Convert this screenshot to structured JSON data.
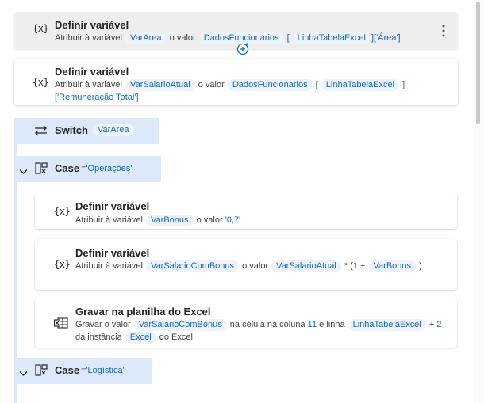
{
  "steps": [
    {
      "icon": "{x}",
      "title": "Definir variável",
      "desc": {
        "assign": "Atribuir à variável",
        "var": "VarArea",
        "value_label": "o valor",
        "expr_var": "DadosFuncionarios",
        "bracket_open": "[",
        "index_var": "LinhaTabelaExcel",
        "tail": "]['Área']"
      }
    },
    {
      "icon": "{x}",
      "title": "Definir variável",
      "desc": {
        "assign": "Atribuir à variável",
        "var": "VarSalarioAtual",
        "value_label": "o valor",
        "expr_var": "DadosFuncionarios",
        "bracket_open": "[",
        "index_var": "LinhaTabelaExcel",
        "bracket_close": "]",
        "tail": "['Remuneração Total']"
      }
    }
  ],
  "switch": {
    "label": "Switch",
    "var": "VarArea"
  },
  "case1": {
    "label": "Case",
    "eq": "=",
    "value": "'Operações'",
    "actions": [
      {
        "icon": "{x}",
        "title": "Definir variável",
        "assign": "Atribuir à variável",
        "var": "VarBonus",
        "value_label": "o valor",
        "value": "'0,7'"
      },
      {
        "icon": "{x}",
        "title": "Definir variável",
        "assign": "Atribuir à variável",
        "var": "VarSalarioComBonus",
        "value_label": "o valor",
        "expr_var": "VarSalarioAtual",
        "op": "* (1 +",
        "expr_var2": "VarBonus",
        "close": ")"
      },
      {
        "icon": "excel-write",
        "title": "Gravar na planilha do Excel",
        "write": "Gravar o valor",
        "var": "VarSalarioComBonus",
        "col_label": "na célula na coluna",
        "col": "11",
        "row_label": "e linha",
        "row_var": "LinhaTabelaExcel",
        "plus": "+",
        "plus_val": "2",
        "inst_label": "da instância",
        "inst_var": "Excel",
        "suffix": "do Excel"
      }
    ]
  },
  "case2": {
    "label": "Case",
    "eq": "=",
    "value": "'Logística'"
  },
  "colors": {
    "accent": "#0f6cbd",
    "token_bg": "#eef3fa",
    "band": "#dce9fb",
    "selected": "#eeeeee"
  }
}
